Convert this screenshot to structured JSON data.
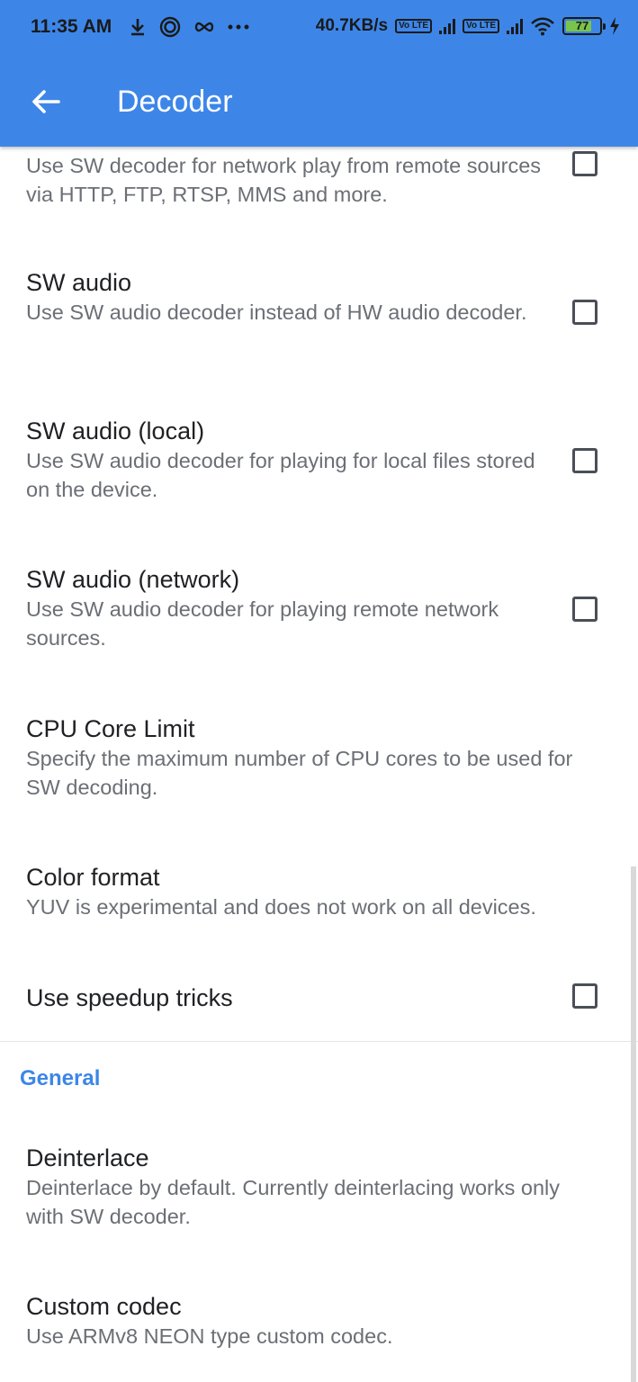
{
  "status_bar": {
    "time": "11:35 AM",
    "left_icons": [
      "download-icon",
      "shield-swirl-icon",
      "infinity-icon",
      "more-dots-icon"
    ],
    "net_speed": "40.7KB/s",
    "sim1_label": "Vo LTE",
    "sim2_label": "Vo LTE",
    "battery_level": "77",
    "battery_fraction": 0.77
  },
  "appbar": {
    "title": "Decoder",
    "back_icon": "arrow-left-icon",
    "color": "#3d86e8"
  },
  "prefs": {
    "network_sw": {
      "summary": "Use SW decoder for network play from remote sources via HTTP, FTP, RTSP, MMS and more.",
      "checked": false
    },
    "sw_audio": {
      "title": "SW audio",
      "summary": "Use SW audio decoder instead of HW audio decoder.",
      "checked": false
    },
    "sw_audio_local": {
      "title": "SW audio (local)",
      "summary": "Use SW audio decoder for playing for local files stored on the device.",
      "checked": false
    },
    "sw_audio_network": {
      "title": "SW audio (network)",
      "summary": "Use SW audio decoder for playing remote network sources.",
      "checked": false
    },
    "cpu_core_limit": {
      "title": "CPU Core Limit",
      "summary": "Specify the maximum number of CPU cores to be used for SW decoding."
    },
    "color_format": {
      "title": "Color format",
      "summary": "YUV is experimental and does not work on all devices."
    },
    "speedup_tricks": {
      "title": "Use speedup tricks",
      "checked": false
    },
    "general_header": "General",
    "deinterlace": {
      "title": "Deinterlace",
      "summary": "Deinterlace by default. Currently deinterlacing works only with SW decoder."
    },
    "custom_codec": {
      "title": "Custom codec",
      "summary": "Use ARMv8 NEON type custom codec."
    }
  }
}
